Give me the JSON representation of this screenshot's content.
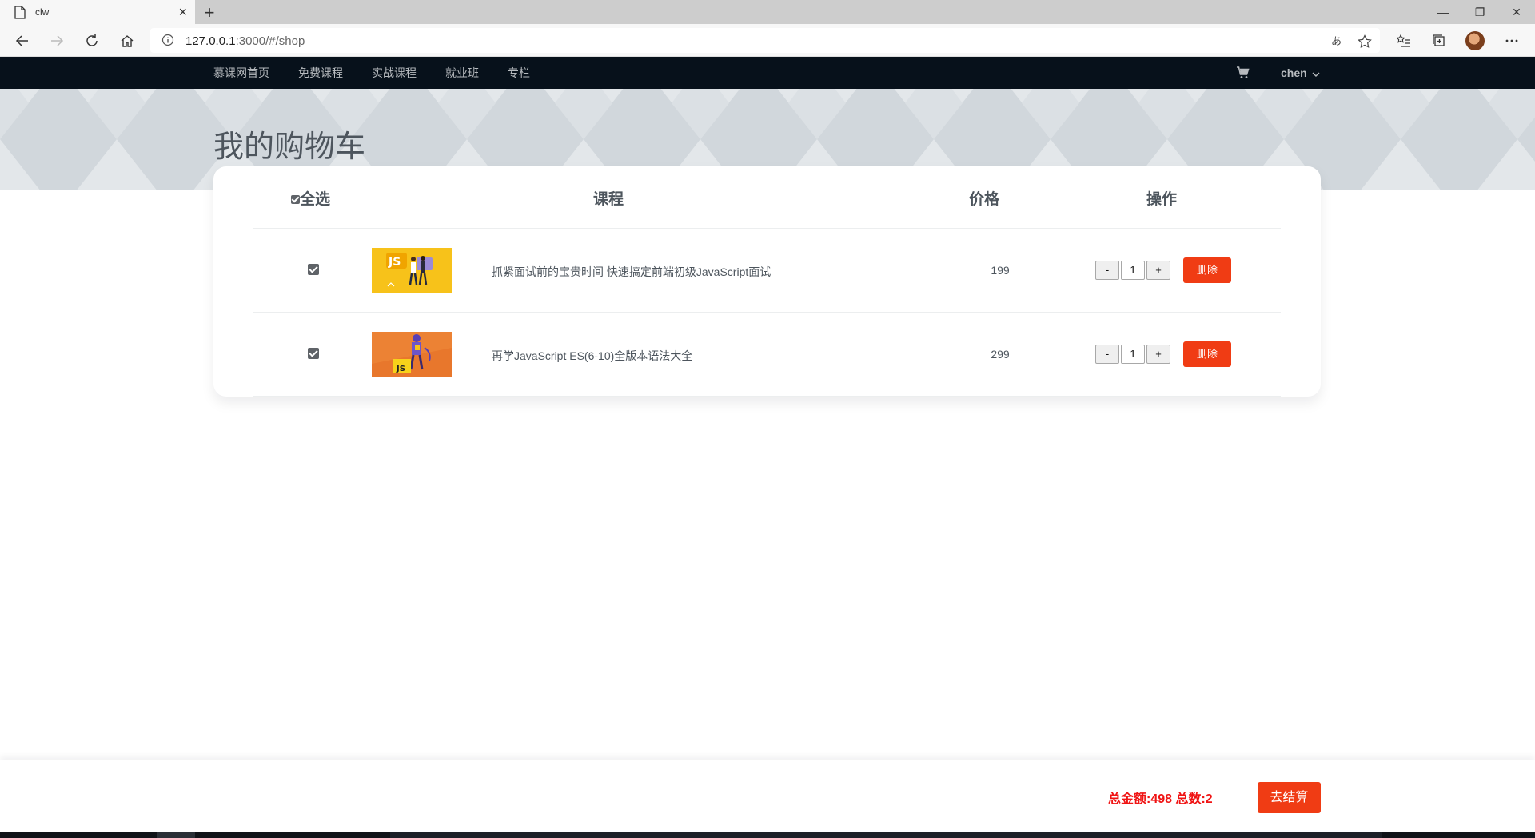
{
  "browser": {
    "tab_title": "clw",
    "new_tab": "+",
    "url_host": "127.0.0.1",
    "url_rest": ":3000/#/shop",
    "window_controls": {
      "minimize": "—",
      "restore": "❐",
      "close": "✕"
    }
  },
  "site_nav": {
    "items": [
      {
        "label": "慕课网首页"
      },
      {
        "label": "免费课程"
      },
      {
        "label": "实战课程"
      },
      {
        "label": "就业班"
      },
      {
        "label": "专栏"
      }
    ],
    "user": "chen"
  },
  "page": {
    "title": "我的购物车"
  },
  "cart": {
    "headers": {
      "select_all": "全选",
      "course": "课程",
      "price": "价格",
      "action": "操作"
    },
    "items": [
      {
        "checked": true,
        "name": "抓紧面试前的宝贵时间 快速搞定前端初级JavaScript面试",
        "price": "199",
        "quantity": "1",
        "thumb_label": "JS",
        "minus": "-",
        "plus": "+",
        "delete": "删除"
      },
      {
        "checked": true,
        "name": "再学JavaScript ES(6-10)全版本语法大全",
        "price": "299",
        "quantity": "1",
        "thumb_label": "JS",
        "minus": "-",
        "plus": "+",
        "delete": "删除"
      }
    ]
  },
  "footer": {
    "totals": "总金额:498 总数:2",
    "checkout": "去结算"
  },
  "colors": {
    "nav_bg": "#07111b",
    "accent": "#f03c14",
    "total_text": "#f01414"
  }
}
